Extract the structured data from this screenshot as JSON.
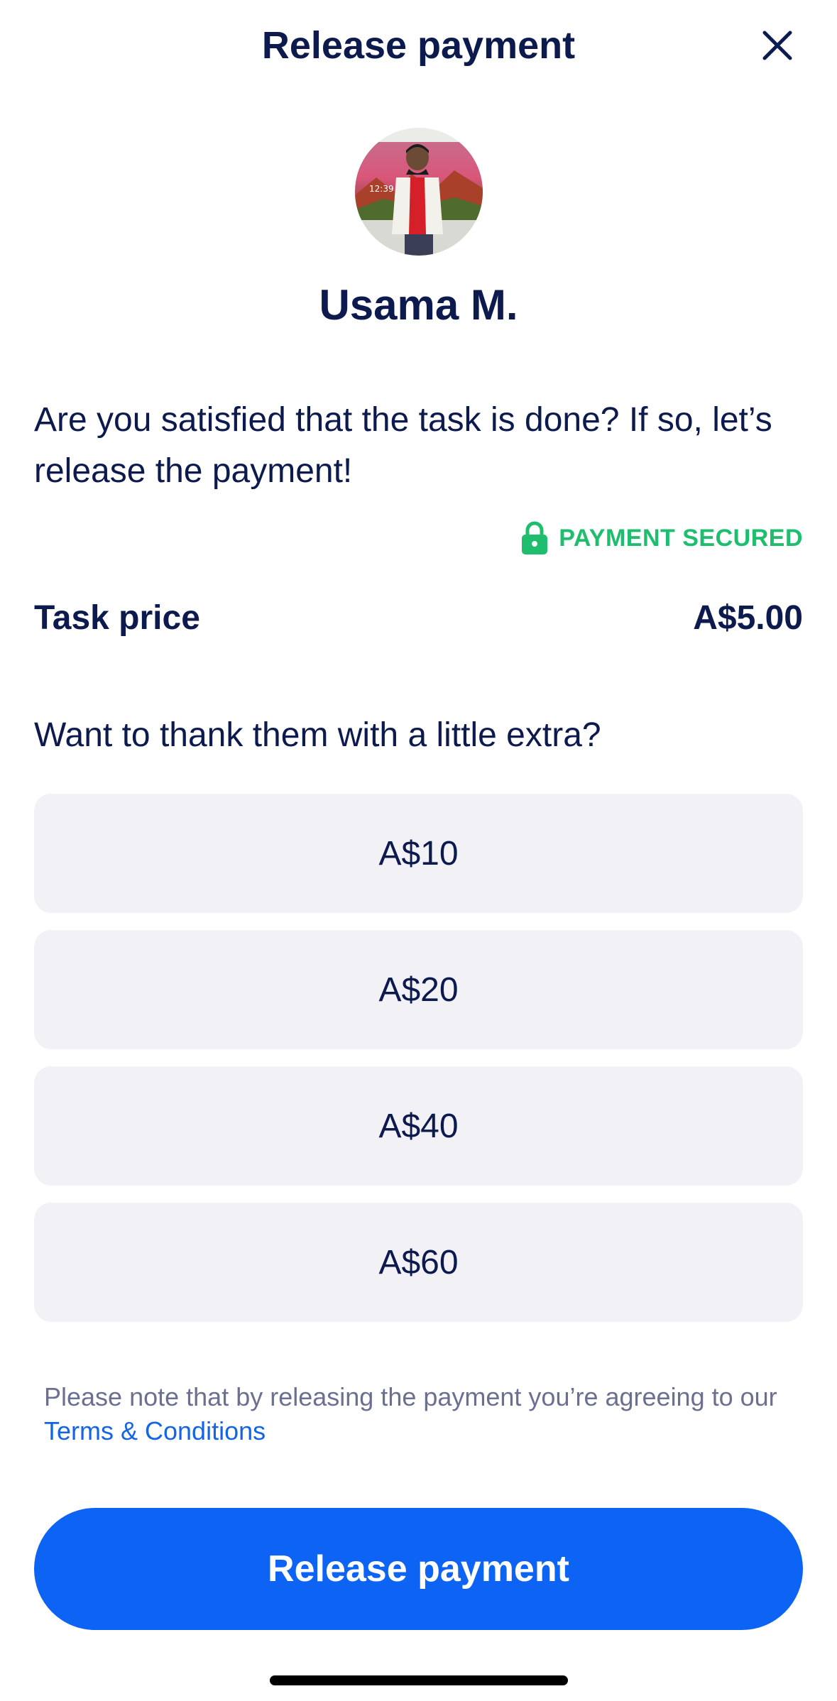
{
  "header": {
    "title": "Release payment",
    "close_icon": "close-icon"
  },
  "tasker": {
    "name": "Usama M.",
    "avatar": "avatar-photo"
  },
  "prompt": "Are you satisfied that the task is done? If so, let’s release the payment!",
  "security": {
    "icon": "lock-icon",
    "label": "PAYMENT SECURED",
    "color": "#1fbe6e"
  },
  "price": {
    "label": "Task price",
    "value": "A$5.00"
  },
  "tip": {
    "question": "Want to thank them with a little extra?",
    "options": [
      "A$10",
      "A$20",
      "A$40",
      "A$60"
    ]
  },
  "note": {
    "text": "Please note that by releasing the payment you’re agreeing to our ",
    "link": "Terms & Conditions"
  },
  "action": {
    "label": "Release payment",
    "color": "#0c63f4"
  }
}
